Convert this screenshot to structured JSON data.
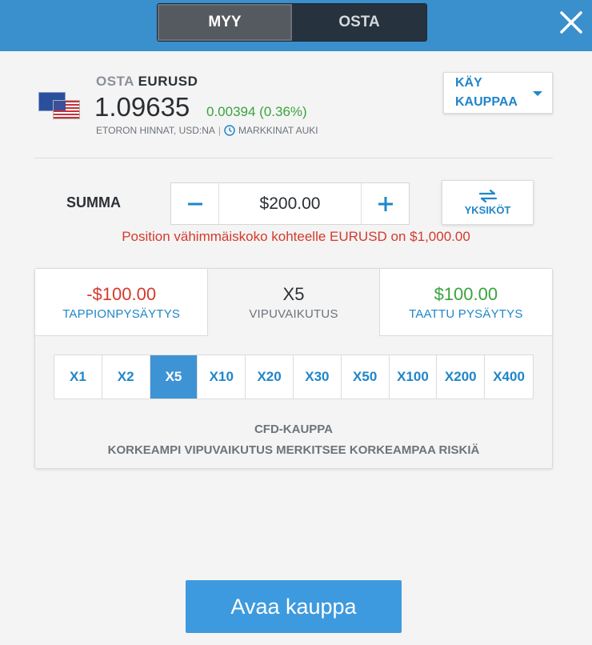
{
  "header": {
    "sell_label": "MYY",
    "buy_label": "OSTA",
    "close_icon": "close-icon"
  },
  "instrument": {
    "action": "OSTA",
    "symbol": "EURUSD",
    "price": "1.09635",
    "change": "0.00394 (0.36%)",
    "price_source": "ETORON HINNAT, USD:NA",
    "separator": "|",
    "market_status": "MARKKINAT AUKI",
    "trade_menu_label": "KÄY KAUPPAA"
  },
  "amount": {
    "label": "SUMMA",
    "value": "$200.00",
    "units_label": "YKSIKÖT",
    "warning": "Position vähimmäiskoko kohteelle EURUSD on $1,000.00"
  },
  "tabs": [
    {
      "value": "-$100.00",
      "label": "TAPPIONPYSÄYTYS"
    },
    {
      "value": "X5",
      "label": "VIPUVAIKUTUS"
    },
    {
      "value": "$100.00",
      "label": "TAATTU PYSÄYTYS"
    }
  ],
  "leverage": {
    "options": [
      "X1",
      "X2",
      "X5",
      "X10",
      "X20",
      "X30",
      "X50",
      "X100",
      "X200",
      "X400"
    ],
    "selected": "X5"
  },
  "notice": {
    "line1": "CFD-KAUPPA",
    "line2": "KORKEAMPI VIPUVAIKUTUS MERKITSEE KORKEAMPAA RISKIÄ"
  },
  "open_trade_label": "Avaa kauppa",
  "colors": {
    "header_blue": "#3a8fcd",
    "accent_blue": "#1f86c8",
    "positive": "#3aa33e",
    "negative": "#d43a2c"
  }
}
